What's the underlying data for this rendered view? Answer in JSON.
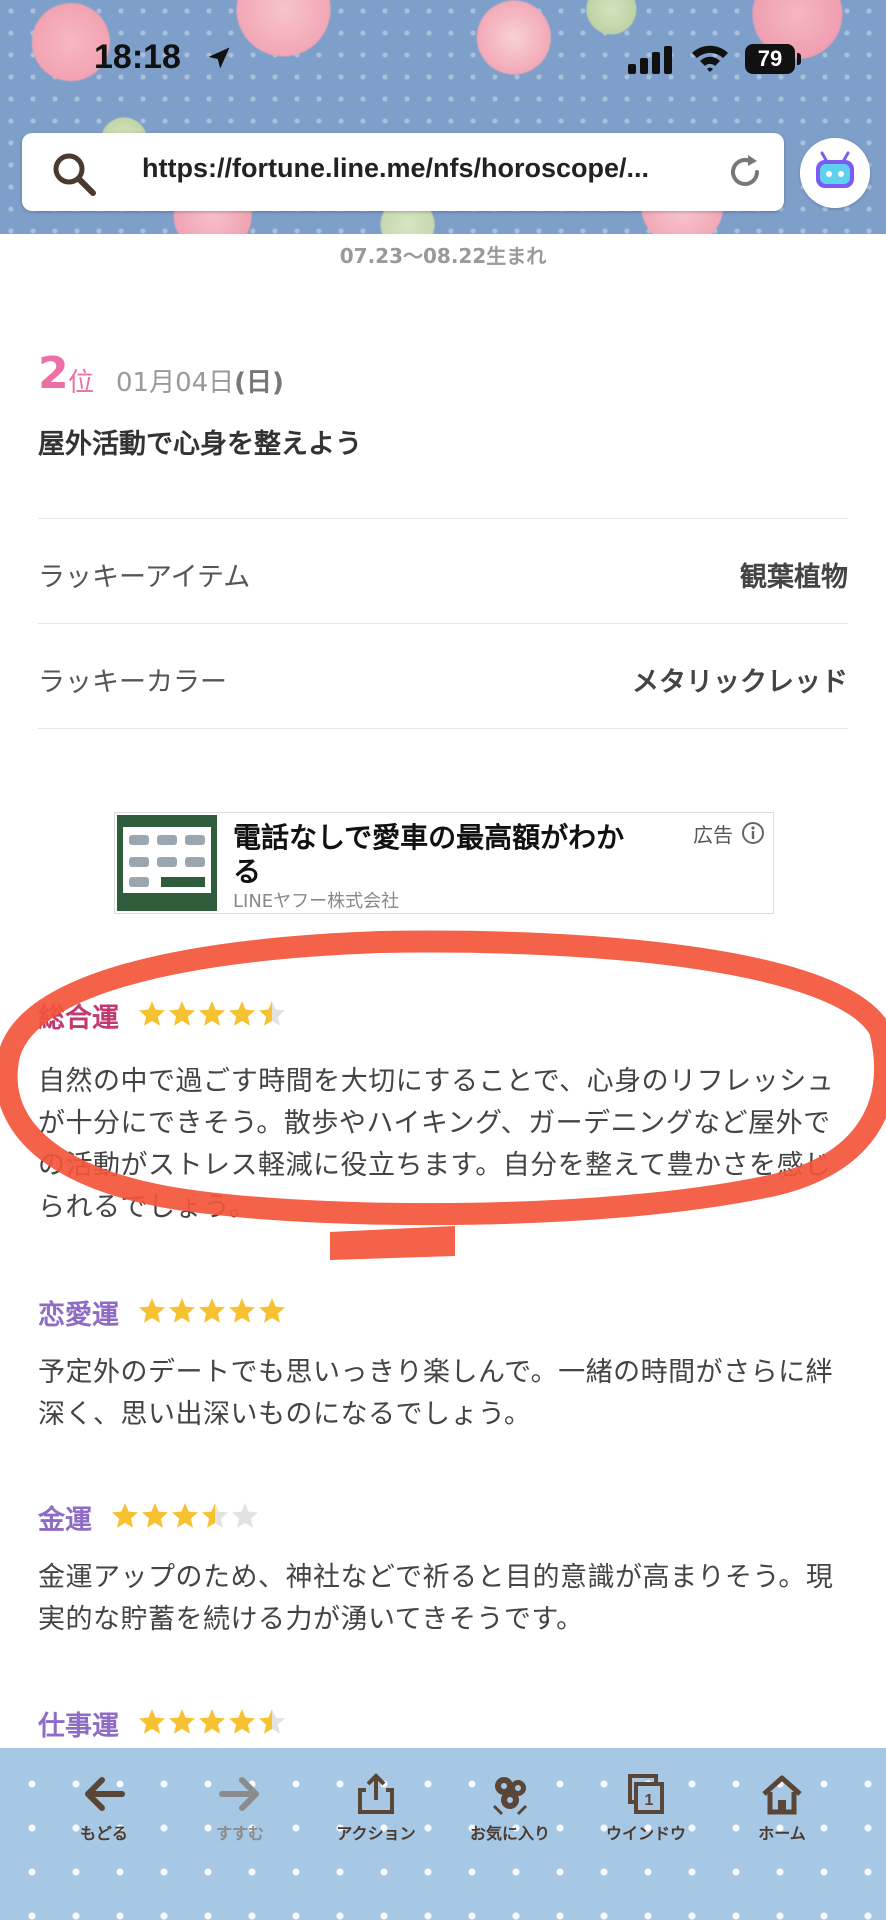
{
  "status_bar": {
    "time": "18:18",
    "battery": "79"
  },
  "browser": {
    "url": "https://fortune.line.me/nfs/horoscope/..."
  },
  "fortune": {
    "birth_range": "07.23〜08.22生まれ",
    "rank_number": "2",
    "rank_suffix": "位",
    "date": "01月04日",
    "weekday": "(日)",
    "headline": "屋外活動で心身を整えよう",
    "lucky_item_label": "ラッキーアイテム",
    "lucky_item_value": "観葉植物",
    "lucky_color_label": "ラッキーカラー",
    "lucky_color_value": "メタリックレッド"
  },
  "ad": {
    "title": "電話なしで愛車の最高額がわかる",
    "sponsor": "LINEヤフー株式会社",
    "label": "広告"
  },
  "sections": [
    {
      "title": "総合運",
      "rating": 4.5,
      "text": "自然の中で過ごす時間を大切にすることで、心身のリフレッシュが十分にできそう。散歩やハイキング、ガーデニングなど屋外での活動がストレス軽減に役立ちます。自分を整えて豊かさを感じられるでしょう。"
    },
    {
      "title": "恋愛運",
      "rating": 5,
      "text": "予定外のデートでも思いっきり楽しんで。一緒の時間がさらに絆深く、思い出深いものになるでしょう。"
    },
    {
      "title": "金運",
      "rating": 3.5,
      "text": "金運アップのため、神社などで祈ると目的意識が高まりそう。現実的な貯蓄を続ける力が湧いてきそうです。"
    },
    {
      "title": "仕事運",
      "rating": 4.5,
      "text": ""
    }
  ],
  "colors": {
    "accent_pink": "#ec6fa5",
    "section_purple": "#8e6cc6",
    "star_gold": "#f7c232",
    "annotation_red": "#f2553a"
  },
  "toolbar": {
    "back": "もどる",
    "forward": "すすむ",
    "action": "アクション",
    "favorites": "お気に入り",
    "window": "ウインドウ",
    "home": "ホーム"
  }
}
